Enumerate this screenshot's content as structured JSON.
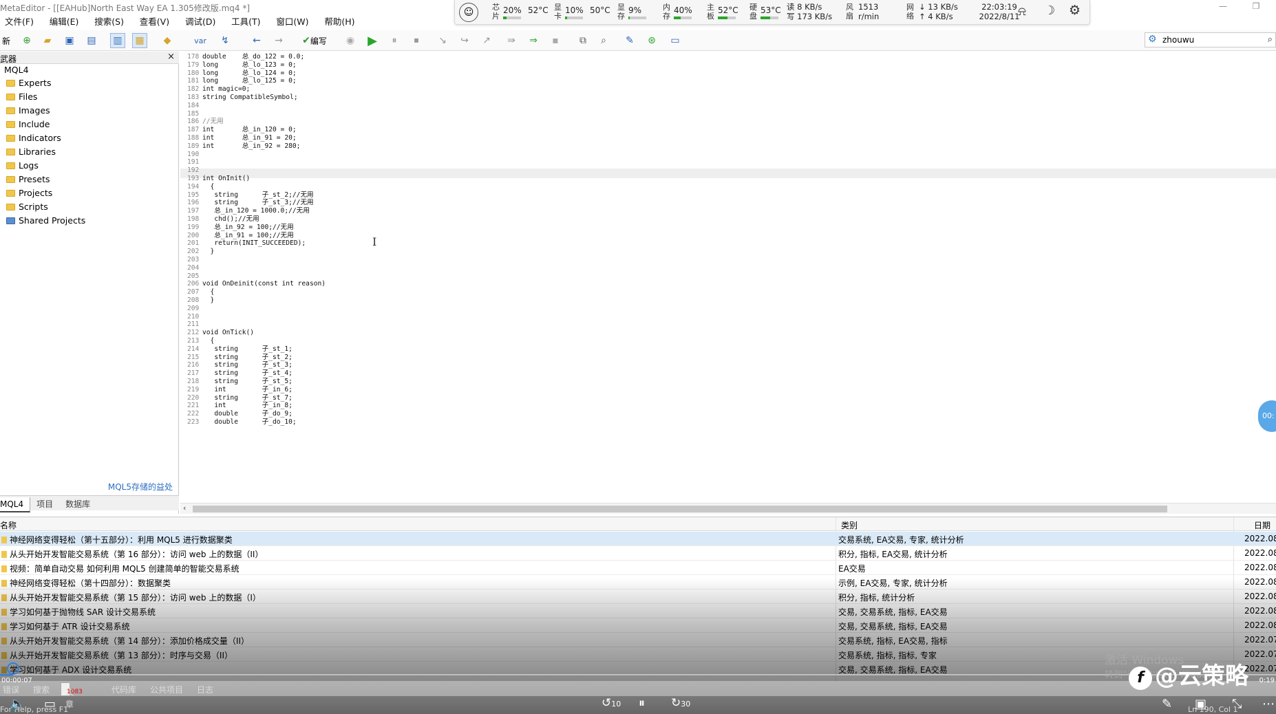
{
  "window": {
    "title": "MetaEditor - [[EAHub]North East Way EA 1.305修改版.mq4 *]",
    "minimize": "—",
    "restore": "❐"
  },
  "menu": [
    "文件(F)",
    "编辑(E)",
    "搜索(S)",
    "查看(V)",
    "调试(D)",
    "工具(T)",
    "窗口(W)",
    "帮助(H)"
  ],
  "monitor": {
    "cpu": {
      "label": "芯片",
      "value": "20%",
      "temp": "52°C",
      "level": 0.2
    },
    "gpu": {
      "label": "显卡",
      "value": "10%",
      "temp": "50°C",
      "level": 0.1
    },
    "vram": {
      "label": "显存",
      "value": "9%",
      "level": 0.09
    },
    "mem": {
      "label": "内存",
      "value": "40%",
      "level": 0.4
    },
    "board": {
      "label": "主板",
      "temp": "52°C",
      "level": 0.52
    },
    "disk": {
      "label": "硬盘",
      "temp": "53°C",
      "level": 0.53
    },
    "disk_rw": {
      "read": "读 8 KB/s",
      "write": "写 173 KB/s"
    },
    "fan": {
      "label": "风扇",
      "speed": "1513",
      "unit": "r/min"
    },
    "net": {
      "label": "网络",
      "down": "↓ 13 KB/s",
      "up": "↑ 4 KB/s"
    },
    "clock": {
      "time": "22:03:19",
      "date": "2022/8/11"
    }
  },
  "toolbar": {
    "new_label": "新",
    "compile_label": "编写",
    "var_label": "var"
  },
  "search": {
    "value": "zhouwu"
  },
  "navigator": {
    "header": "武器",
    "root": "MQL4",
    "items": [
      "Experts",
      "Files",
      "Images",
      "Include",
      "Indicators",
      "Libraries",
      "Logs",
      "Presets",
      "Projects",
      "Scripts",
      "Shared Projects"
    ],
    "link": "MQL5存储的益处",
    "tabs": [
      "MQL4",
      "项目",
      "数据库"
    ]
  },
  "code": [
    {
      "n": "178",
      "t": "double    总_do_122 = 0.0;"
    },
    {
      "n": "179",
      "t": "long      总_lo_123 = 0;"
    },
    {
      "n": "180",
      "t": "long      总_lo_124 = 0;"
    },
    {
      "n": "181",
      "t": "long      总_lo_125 = 0;"
    },
    {
      "n": "182",
      "t": "int magic=0;"
    },
    {
      "n": "183",
      "t": "string CompatibleSymbol;"
    },
    {
      "n": "184",
      "t": ""
    },
    {
      "n": "185",
      "t": ""
    },
    {
      "n": "186",
      "t": "//无用"
    },
    {
      "n": "187",
      "t": "int       总_in_120 = 0;"
    },
    {
      "n": "188",
      "t": "int       总_in_91 = 20;"
    },
    {
      "n": "189",
      "t": "int       总_in_92 = 280;"
    },
    {
      "n": "190",
      "t": ""
    },
    {
      "n": "191",
      "t": ""
    },
    {
      "n": "192",
      "t": ""
    },
    {
      "n": "193",
      "t": "int OnInit()"
    },
    {
      "n": "194",
      "t": "  {"
    },
    {
      "n": "195",
      "t": "   string      子_st_2;//无用"
    },
    {
      "n": "196",
      "t": "   string      子_st_3;//无用"
    },
    {
      "n": "197",
      "t": "   总_in_120 = 1000.0;//无用"
    },
    {
      "n": "198",
      "t": "   chd();//无用"
    },
    {
      "n": "199",
      "t": "   总_in_92 = 100;//无用"
    },
    {
      "n": "200",
      "t": "   总_in_91 = 100;//无用"
    },
    {
      "n": "201",
      "t": "   return(INIT_SUCCEEDED);"
    },
    {
      "n": "202",
      "t": "  }"
    },
    {
      "n": "203",
      "t": ""
    },
    {
      "n": "204",
      "t": ""
    },
    {
      "n": "205",
      "t": ""
    },
    {
      "n": "206",
      "t": "void OnDeinit(const int reason)"
    },
    {
      "n": "207",
      "t": "  {"
    },
    {
      "n": "208",
      "t": "  }"
    },
    {
      "n": "209",
      "t": ""
    },
    {
      "n": "210",
      "t": ""
    },
    {
      "n": "211",
      "t": ""
    },
    {
      "n": "212",
      "t": "void OnTick()"
    },
    {
      "n": "213",
      "t": "  {"
    },
    {
      "n": "214",
      "t": "   string      子_st_1;"
    },
    {
      "n": "215",
      "t": "   string      子_st_2;"
    },
    {
      "n": "216",
      "t": "   string      子_st_3;"
    },
    {
      "n": "217",
      "t": "   string      子_st_4;"
    },
    {
      "n": "218",
      "t": "   string      子_st_5;"
    },
    {
      "n": "219",
      "t": "   int         子_in_6;"
    },
    {
      "n": "220",
      "t": "   string      子_st_7;"
    },
    {
      "n": "221",
      "t": "   int         子_in_8;"
    },
    {
      "n": "222",
      "t": "   double      子_do_9;"
    },
    {
      "n": "223",
      "t": "   double      子_do_10;"
    }
  ],
  "articles": {
    "headers": {
      "name": "名称",
      "category": "类别",
      "date": "日期"
    },
    "rows": [
      {
        "name": "神经网络变得轻松（第十五部分）：利用 MQL5 进行数据聚类",
        "category": "交易系统, EA交易, 专家, 统计分析",
        "date": "2022.08"
      },
      {
        "name": "从头开始开发智能交易系统（第 16 部分）：访问 web 上的数据（II）",
        "category": "积分, 指标, EA交易, 统计分析",
        "date": "2022.08"
      },
      {
        "name": "视频：简单自动交易  如何利用 MQL5 创建简单的智能交易系统",
        "category": "EA交易",
        "date": "2022.08"
      },
      {
        "name": "神经网络变得轻松（第十四部分）：数据聚类",
        "category": "示例, EA交易, 专家, 统计分析",
        "date": "2022.08"
      },
      {
        "name": "从头开始开发智能交易系统（第 15 部分）：访问 web 上的数据（I）",
        "category": "积分, 指标, 统计分析",
        "date": "2022.08"
      },
      {
        "name": "学习如何基于抛物线 SAR 设计交易系统",
        "category": "交易, 交易系统, 指标, EA交易",
        "date": "2022.08"
      },
      {
        "name": "学习如何基于 ATR 设计交易系统",
        "category": "交易, 交易系统, 指标, EA交易",
        "date": "2022.08"
      },
      {
        "name": "从头开始开发智能交易系统（第 14 部分）：添加价格成交量（II）",
        "category": "交易系统, 指标, EA交易, 指标",
        "date": "2022.07"
      },
      {
        "name": "从头开始开发智能交易系统（第 13 部分）：时序与交易（II）",
        "category": "交易系统, 指标, 指标, 专家",
        "date": "2022.07"
      },
      {
        "name": "学习如何基于 ADX 设计交易系统",
        "category": "交易, 交易系统, 指标, EA交易",
        "date": "2022.07"
      }
    ]
  },
  "bottom_tabs": [
    {
      "label": "错误"
    },
    {
      "label": "搜索"
    },
    {
      "label": "文章",
      "badge": "1083"
    },
    {
      "label": "代码库"
    },
    {
      "label": "公共项目"
    },
    {
      "label": "日志"
    }
  ],
  "status": {
    "left": "For Help, press F1",
    "right": "Ln 190, Col 1"
  },
  "player": {
    "elapsed": "00:00:07",
    "total": "0:19",
    "progress": 0.01,
    "rewind_label": "10",
    "forward_label": "30"
  },
  "watermark": {
    "text": "@云策略",
    "logo": "f"
  },
  "activate_windows": {
    "line1": "激活 Windows",
    "line2": "转到“设置”以激活 Windows。"
  },
  "bubble": {
    "text": "00:"
  }
}
